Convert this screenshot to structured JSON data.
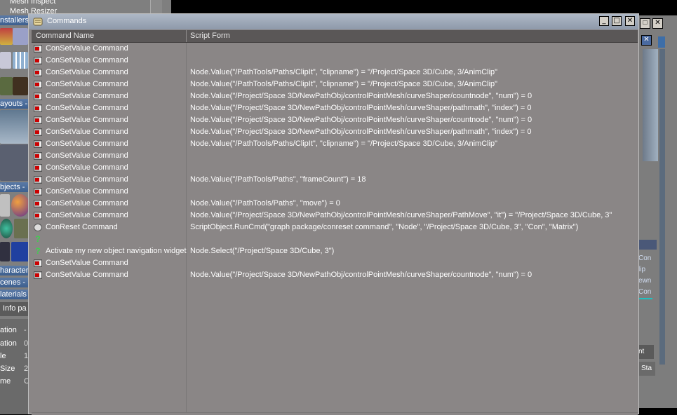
{
  "background_left": {
    "top_items": [
      "Mesh Inspect",
      "Mesh Resizer"
    ],
    "sections": [
      "nstallers",
      "ayouts -",
      "bjects -",
      "haracter",
      "cenes -",
      "laterials"
    ],
    "info_tab": "Info pa",
    "props": [
      "ation",
      "ation",
      "le",
      "Size",
      "me"
    ],
    "prop_values": [
      "-",
      "0",
      "1",
      "2",
      "C"
    ]
  },
  "background_right": {
    "labels": [
      "Con",
      "lip",
      "ewn",
      "Con",
      "nt",
      "Sta"
    ]
  },
  "window": {
    "title": "Commands",
    "buttons": {
      "minimize": "_",
      "maximize": "□",
      "close": "✕"
    }
  },
  "table": {
    "columns": [
      "Command Name",
      "Script Form"
    ],
    "rows": [
      {
        "icon": "command-icon",
        "name": "ConSetValue Command",
        "script": ""
      },
      {
        "icon": "command-icon",
        "name": "ConSetValue Command",
        "script": ""
      },
      {
        "icon": "command-icon",
        "name": "ConSetValue Command",
        "script": "Node.Value(\"/PathTools/Paths/ClipIt\", \"clipname\") = \"/Project/Space 3D/Cube, 3/AnimClip\""
      },
      {
        "icon": "command-icon",
        "name": "ConSetValue Command",
        "script": "Node.Value(\"/PathTools/Paths/ClipIt\", \"clipname\") = \"/Project/Space 3D/Cube, 3/AnimClip\""
      },
      {
        "icon": "command-icon",
        "name": "ConSetValue Command",
        "script": "Node.Value(\"/Project/Space 3D/NewPathObj/controlPointMesh/curveShaper/countnode\", \"num\") = 0"
      },
      {
        "icon": "command-icon",
        "name": "ConSetValue Command",
        "script": "Node.Value(\"/Project/Space 3D/NewPathObj/controlPointMesh/curveShaper/pathmath\", \"index\") = 0"
      },
      {
        "icon": "command-icon",
        "name": "ConSetValue Command",
        "script": "Node.Value(\"/Project/Space 3D/NewPathObj/controlPointMesh/curveShaper/countnode\", \"num\") = 0"
      },
      {
        "icon": "command-icon",
        "name": "ConSetValue Command",
        "script": "Node.Value(\"/Project/Space 3D/NewPathObj/controlPointMesh/curveShaper/pathmath\", \"index\") = 0"
      },
      {
        "icon": "command-icon",
        "name": "ConSetValue Command",
        "script": "Node.Value(\"/PathTools/Paths/ClipIt\", \"clipname\") = \"/Project/Space 3D/Cube, 3/AnimClip\""
      },
      {
        "icon": "command-icon",
        "name": "ConSetValue Command",
        "script": ""
      },
      {
        "icon": "command-icon",
        "name": "ConSetValue Command",
        "script": ""
      },
      {
        "icon": "command-icon",
        "name": "ConSetValue Command",
        "script": "Node.Value(\"/PathTools/Paths\", \"frameCount\") = 18"
      },
      {
        "icon": "command-icon",
        "name": "ConSetValue Command",
        "script": ""
      },
      {
        "icon": "command-icon",
        "name": "ConSetValue Command",
        "script": "Node.Value(\"/PathTools/Paths\", \"move\") = 0"
      },
      {
        "icon": "command-icon",
        "name": "ConSetValue Command",
        "script": "Node.Value(\"/Project/Space 3D/NewPathObj/controlPointMesh/curveShaper/PathMove\", \"it\") = \"/Project/Space 3D/Cube, 3\""
      },
      {
        "icon": "reset-icon",
        "name": "ConReset Command",
        "script": "ScriptObject.RunCmd(\"graph package/conreset command\", \"Node\", \"/Project/Space 3D/Cube, 3\", \"Con\", \"Matrix\")"
      },
      {
        "icon": "question-icon",
        "name": "",
        "script": ""
      },
      {
        "icon": "question-icon",
        "name": "Activate my new object navigation widget",
        "script": "Node.Select(\"/Project/Space 3D/Cube, 3\")"
      },
      {
        "icon": "command-icon",
        "name": "ConSetValue Command",
        "script": ""
      },
      {
        "icon": "command-icon",
        "name": "ConSetValue Command",
        "script": "Node.Value(\"/Project/Space 3D/NewPathObj/controlPointMesh/curveShaper/countnode\", \"num\") = 0"
      }
    ],
    "empty_rows": 11
  },
  "colors": {
    "accent": "#5a7aa6",
    "table_bg": "#8a8686",
    "header_bg": "#5a5757",
    "question_icon": "#3fd04f"
  }
}
